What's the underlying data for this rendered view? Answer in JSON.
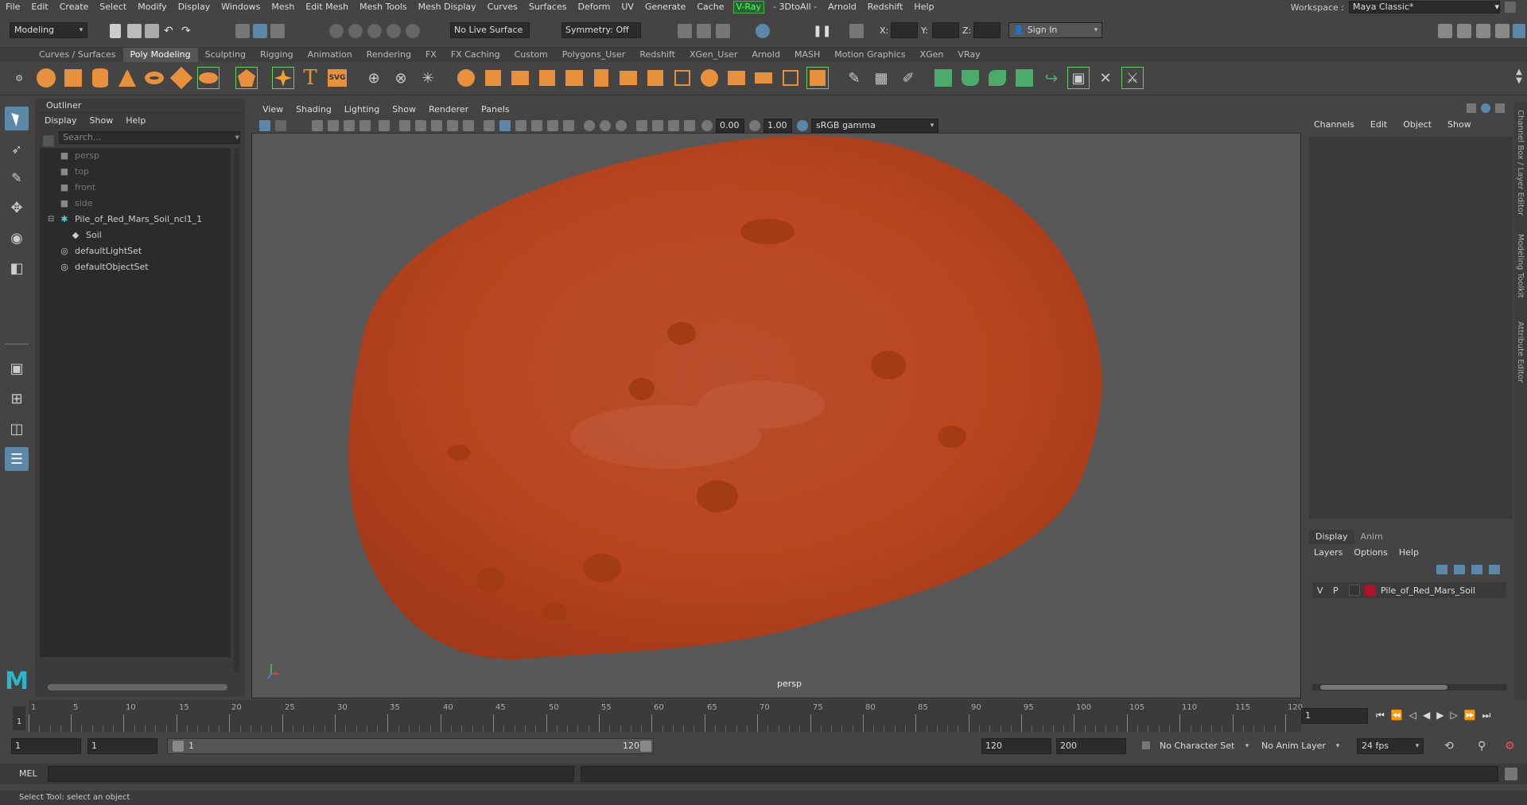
{
  "menubar": {
    "items": [
      "File",
      "Edit",
      "Create",
      "Select",
      "Modify",
      "Display",
      "Windows",
      "Mesh",
      "Edit Mesh",
      "Mesh Tools",
      "Mesh Display",
      "Curves",
      "Surfaces",
      "Deform",
      "UV",
      "Generate",
      "Cache"
    ],
    "vray": "V-Ray",
    "items2": [
      "- 3DtoAll -",
      "Arnold",
      "Redshift",
      "Help"
    ],
    "workspace_label": "Workspace :",
    "workspace_value": "Maya Classic*"
  },
  "statusline": {
    "mode": "Modeling",
    "live_surface": "No Live Surface",
    "symmetry": "Symmetry: Off",
    "x_label": "X:",
    "y_label": "Y:",
    "z_label": "Z:",
    "sign_in": "Sign In"
  },
  "shelf": {
    "tabs": [
      "Curves / Surfaces",
      "Poly Modeling",
      "Sculpting",
      "Rigging",
      "Animation",
      "Rendering",
      "FX",
      "FX Caching",
      "Custom",
      "Polygons_User",
      "Redshift",
      "XGen_User",
      "Arnold",
      "MASH",
      "Motion Graphics",
      "XGen",
      "VRay"
    ],
    "active_tab": "Poly Modeling"
  },
  "outliner": {
    "title": "Outliner",
    "menus": [
      "Display",
      "Show",
      "Help"
    ],
    "search_placeholder": "Search...",
    "items": [
      {
        "label": "persp",
        "type": "camera",
        "dim": true,
        "indent": 0
      },
      {
        "label": "top",
        "type": "camera",
        "dim": true,
        "indent": 0
      },
      {
        "label": "front",
        "type": "camera",
        "dim": true,
        "indent": 0
      },
      {
        "label": "side",
        "type": "camera",
        "dim": true,
        "indent": 0
      },
      {
        "label": "Pile_of_Red_Mars_Soil_ncl1_1",
        "type": "group",
        "dim": false,
        "indent": 0
      },
      {
        "label": "Soil",
        "type": "mesh",
        "dim": false,
        "indent": 1
      },
      {
        "label": "defaultLightSet",
        "type": "set",
        "dim": false,
        "indent": 0
      },
      {
        "label": "defaultObjectSet",
        "type": "set",
        "dim": false,
        "indent": 0
      }
    ]
  },
  "viewport": {
    "menus": [
      "View",
      "Shading",
      "Lighting",
      "Show",
      "Renderer",
      "Panels"
    ],
    "near_value": "0.00",
    "far_value": "1.00",
    "colorspace": "sRGB gamma",
    "camera_label": "persp"
  },
  "channelbox": {
    "menus": [
      "Channels",
      "Edit",
      "Object",
      "Show"
    ]
  },
  "sidetabs": [
    "Channel Box / Layer Editor",
    "Modeling Toolkit",
    "Attribute Editor"
  ],
  "layereditor": {
    "tabs": [
      "Display",
      "Anim"
    ],
    "menus": [
      "Layers",
      "Options",
      "Help"
    ],
    "layer": {
      "v": "V",
      "p": "P",
      "name": "Pile_of_Red_Mars_Soil",
      "color": "#b0102a"
    }
  },
  "timeline": {
    "ticks": [
      "1",
      "5",
      "10",
      "15",
      "20",
      "25",
      "30",
      "35",
      "40",
      "45",
      "50",
      "55",
      "60",
      "65",
      "70",
      "75",
      "80",
      "85",
      "90",
      "95",
      "100",
      "105",
      "110",
      "115",
      "120"
    ],
    "current_frame": "1"
  },
  "range": {
    "start": "1",
    "playback_start": "1",
    "slider_start": "1",
    "slider_end": "120",
    "playback_end": "120",
    "end": "200",
    "character_set": "No Character Set",
    "anim_layer": "No Anim Layer",
    "fps": "24 fps"
  },
  "mel": {
    "label": "MEL"
  },
  "helpline": {
    "text": "Select Tool: select an object"
  }
}
